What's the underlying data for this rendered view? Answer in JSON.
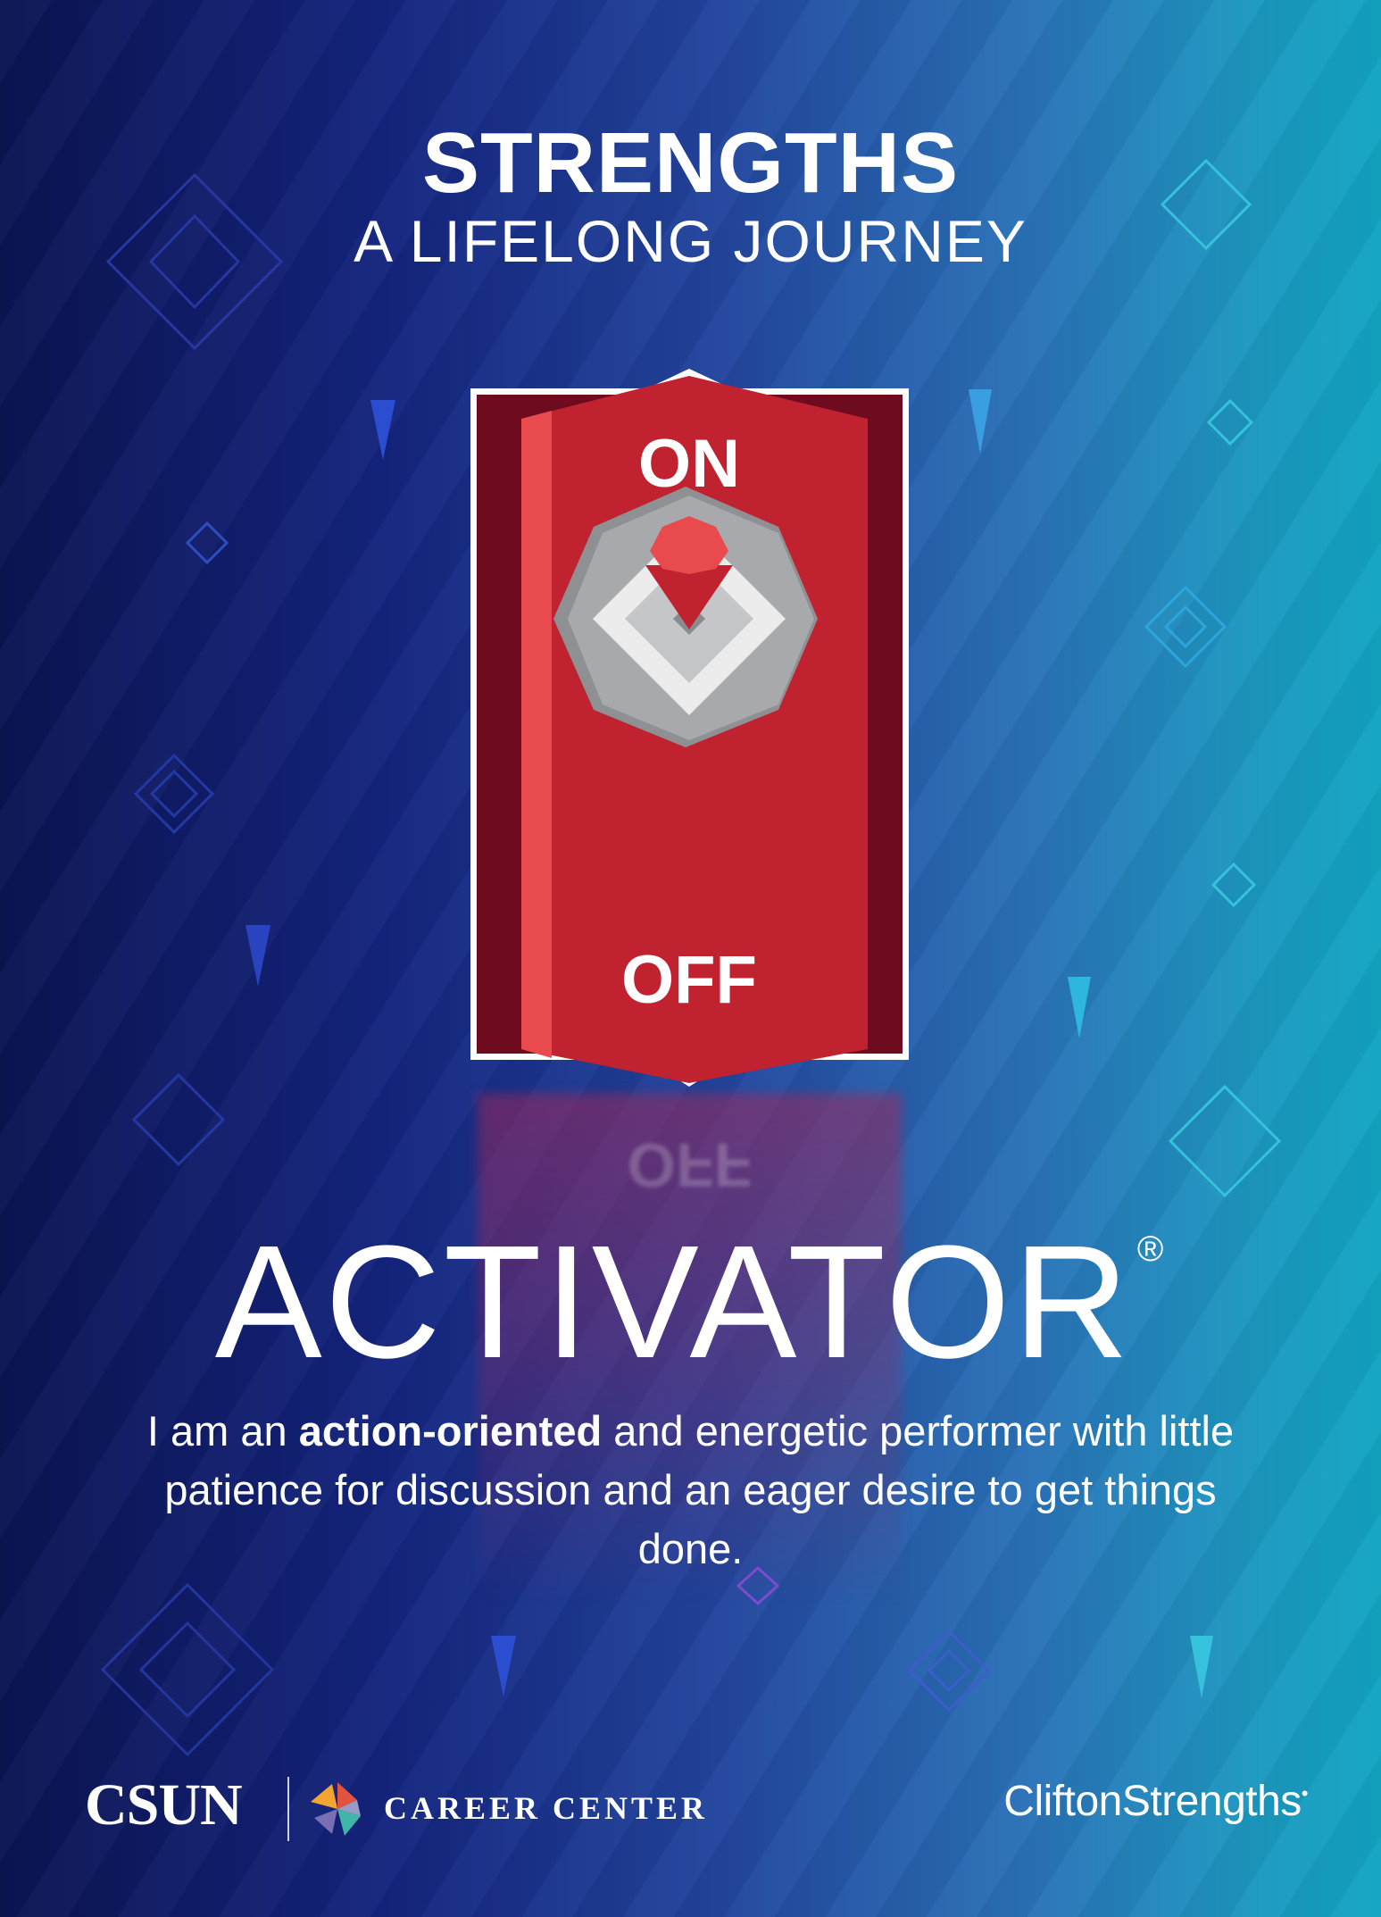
{
  "poster": {
    "title": "STRENGTHS",
    "subtitle": "A LIFELONG JOURNEY",
    "switch": {
      "on_label": "ON",
      "off_label": "OFF"
    },
    "theme_name": "ACTIVATOR",
    "registered_mark": "®",
    "description": {
      "before": "I am an ",
      "bold": "action-oriented",
      "after": " and energetic performer with little patience for discussion and an eager desire to get things done."
    }
  },
  "footer": {
    "left_logo_text": "CSUN",
    "department_text": "CAREER CENTER",
    "right_brand_text": "CliftonStrengths",
    "right_brand_mark": "•"
  },
  "colors": {
    "background_left": "#0b1452",
    "background_right": "#12a5c2",
    "switch_red": "#c0222f",
    "switch_dark_red": "#6e0b1f",
    "switch_light_red": "#e94a4e",
    "switch_gray": "#a8a9ac",
    "text": "#ffffff"
  },
  "icons": [
    "diamond-outline-icon",
    "triangle-icon",
    "toggle-switch-icon",
    "career-center-logo-icon"
  ]
}
